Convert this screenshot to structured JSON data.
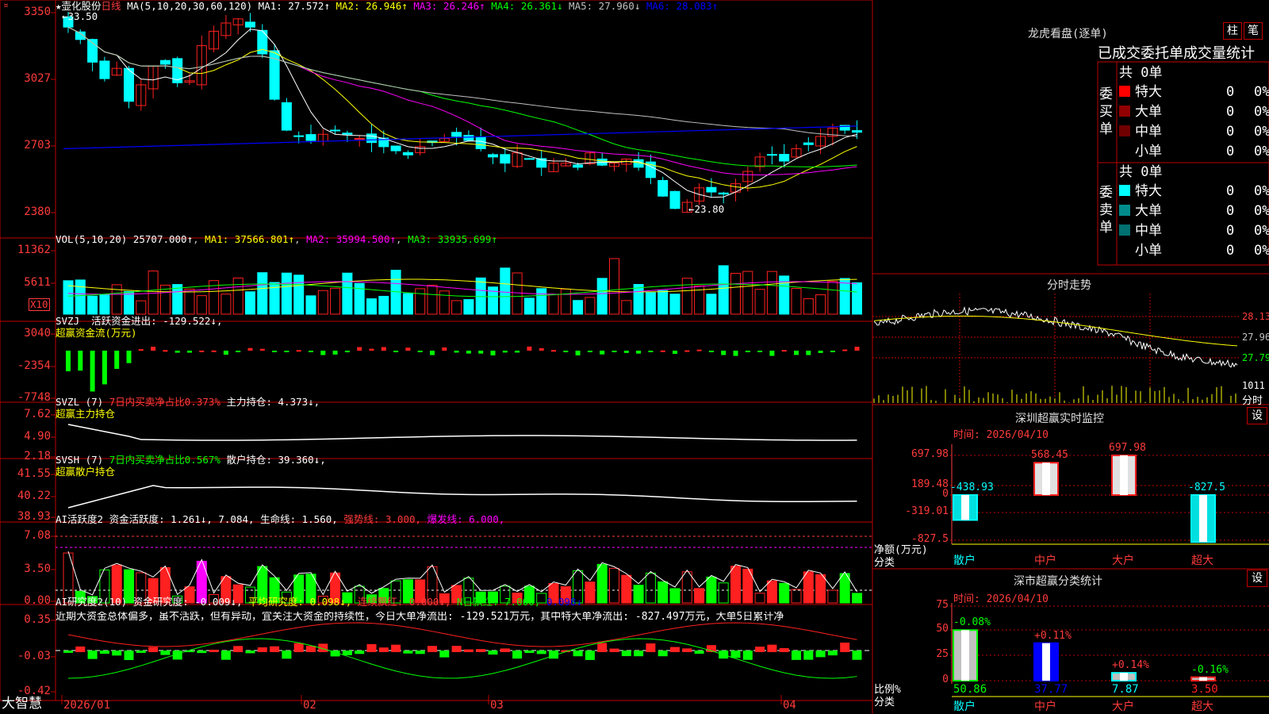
{
  "main": {
    "header_star": "★",
    "stock_name": "壶化股份",
    "period": "日线",
    "ma_params": "MA(5,10,20,30,60,120)",
    "ma": [
      {
        "label": "MA1:",
        "value": "27.572",
        "arrow": "↑",
        "color": "#ffffff"
      },
      {
        "label": "MA2:",
        "value": "26.946",
        "arrow": "↑",
        "color": "#ffff00"
      },
      {
        "label": "MA3:",
        "value": "26.246",
        "arrow": "↑",
        "color": "#ff00ff"
      },
      {
        "label": "MA4:",
        "value": "26.361",
        "arrow": "↓",
        "color": "#00ff00"
      },
      {
        "label": "MA5:",
        "value": "27.960",
        "arrow": "↓",
        "color": "#c0c0c0"
      },
      {
        "label": "MA6:",
        "value": "28.083",
        "arrow": "↑",
        "color": "#0000ff"
      }
    ],
    "high_mark": "33.50",
    "low_mark": "23.80",
    "y_ticks": [
      "3350",
      "3027",
      "2703",
      "2380"
    ]
  },
  "vol": {
    "label": "VOL(5,10,20)",
    "value": "25707.000↑",
    "ma1": "MA1: 37566.801↑",
    "ma2": "MA2: 35994.500↑",
    "ma3": "MA3: 33935.699↑",
    "y_ticks": [
      "11362",
      "5611"
    ],
    "unit": "X10"
  },
  "svzj": {
    "label": "SVZJ",
    "text": "活跃资金进出: -129.522↓,",
    "sub": "超赢资金流(万元)",
    "y_ticks": [
      "3040",
      "-2354",
      "-7748"
    ]
  },
  "svzl": {
    "label": "SVZL (7)",
    "ratio": "7日内买卖净占比0.373%",
    "hold": "主力持仓: 4.373↓,",
    "sub": "超赢主力持仓",
    "y_ticks": [
      "7.62",
      "4.90",
      "2.18"
    ]
  },
  "svsh": {
    "label": "SVSH (7)",
    "ratio": "7日内买卖净占比0.567%",
    "hold": "散户持仓: 39.360↓,",
    "sub": "超赢散户持仓",
    "y_ticks": [
      "41.55",
      "40.22",
      "38.93"
    ]
  },
  "ai2": {
    "label": "AI活跃度2",
    "a": "资金活跃度: 1.261↓, 7.084,",
    "b": "生命线: 1.560,",
    "c": "强势线: 3.000,",
    "d": "爆发线: 6.000,",
    "y_ticks": [
      "7.08",
      "3.50",
      "0.00"
    ]
  },
  "ai_res": {
    "label": "AI研究度2(10)",
    "a": "资金研究度: -0.009↓,",
    "b": "平均研究度: 0.098↓,",
    "c": "连续飘红: 0.000↓,",
    "d": "N日飘红: 7.000,",
    "e": "0.098↓",
    "comment": "近期大资金总体偏多，虽不活跃，但有异动，宜关注大资金的持续性，今日大单净流出: -129.521万元，其中特大单净流出: -827.497万元，大单5日累计净",
    "y_ticks": [
      "0.35",
      "-0.03",
      "-0.42"
    ]
  },
  "xaxis": {
    "labels": [
      "2026/01",
      "02",
      "03",
      "04"
    ],
    "brand": "大智慧"
  },
  "dragon": {
    "title": "龙虎看盘(逐单)",
    "btn1": "柱",
    "btn2": "笔",
    "sub": "已成交委托单成交量统计",
    "buy_label": "委买单",
    "sell_label": "委卖单",
    "buy_total": "共 0单",
    "sell_total": "共 0单",
    "buy_rows": [
      {
        "name": "特大",
        "num": "0",
        "pct": "0%",
        "color": "#ff0000"
      },
      {
        "name": "大单",
        "num": "0",
        "pct": "0%",
        "color": "#900000"
      },
      {
        "name": "中单",
        "num": "0",
        "pct": "0%",
        "color": "#700000"
      },
      {
        "name": "小单",
        "num": "0",
        "pct": "0%",
        "color": "#000000"
      }
    ],
    "sell_rows": [
      {
        "name": "特大",
        "num": "0",
        "pct": "0%",
        "color": "#00ffff"
      },
      {
        "name": "大单",
        "num": "0",
        "pct": "0%",
        "color": "#008c8c"
      },
      {
        "name": "中单",
        "num": "0",
        "pct": "0%",
        "color": "#007070"
      },
      {
        "name": "小单",
        "num": "0",
        "pct": "0%",
        "color": "#000000"
      }
    ]
  },
  "intraday": {
    "title": "分时走势",
    "prices": [
      "28.13",
      "27.96",
      "27.79"
    ],
    "vol": "1011",
    "vol_label": "分时"
  },
  "sz_monitor": {
    "title": "深圳超赢实时监控",
    "btn": "设",
    "time": "时间: 2026/04/10",
    "y_ticks": [
      "697.98",
      "189.48",
      "0",
      "-319.01",
      "-827.5"
    ],
    "ylabel": "净额(万元)",
    "xlabel": "分类",
    "categories": [
      "散户",
      "中户",
      "大户",
      "超大"
    ],
    "values": [
      "-438.93",
      "568.45",
      "697.98",
      "-827.5"
    ]
  },
  "sz_class": {
    "title": "深市超赢分类统计",
    "btn": "设",
    "time": "时间: 2026/04/10",
    "y_ticks": [
      "75",
      "50",
      "25",
      "0"
    ],
    "ylabel": "比例%",
    "xlabel": "分类",
    "categories": [
      "散户",
      "中户",
      "大户",
      "超大"
    ],
    "values": [
      "50.86",
      "37.77",
      "7.87",
      "3.50"
    ],
    "changes": [
      "-0.08%",
      "+0.11%",
      "+0.14%",
      "-0.16%"
    ]
  },
  "chart_data": [
    {
      "type": "bar",
      "title": "深圳超赢实时监控",
      "categories": [
        "散户",
        "中户",
        "大户",
        "超大"
      ],
      "values": [
        -438.93,
        568.45,
        697.98,
        -827.5
      ],
      "ylabel": "净额(万元)",
      "xlabel": "分类",
      "ylim": [
        -827.5,
        697.98
      ]
    },
    {
      "type": "bar",
      "title": "深市超赢分类统计",
      "categories": [
        "散户",
        "中户",
        "大户",
        "超大"
      ],
      "values": [
        50.86,
        37.77,
        7.87,
        3.5
      ],
      "changes": [
        "-0.08%",
        "+0.11%",
        "+0.14%",
        "-0.16%"
      ],
      "ylabel": "比例%",
      "xlabel": "分类",
      "ylim": [
        0,
        75
      ]
    }
  ]
}
